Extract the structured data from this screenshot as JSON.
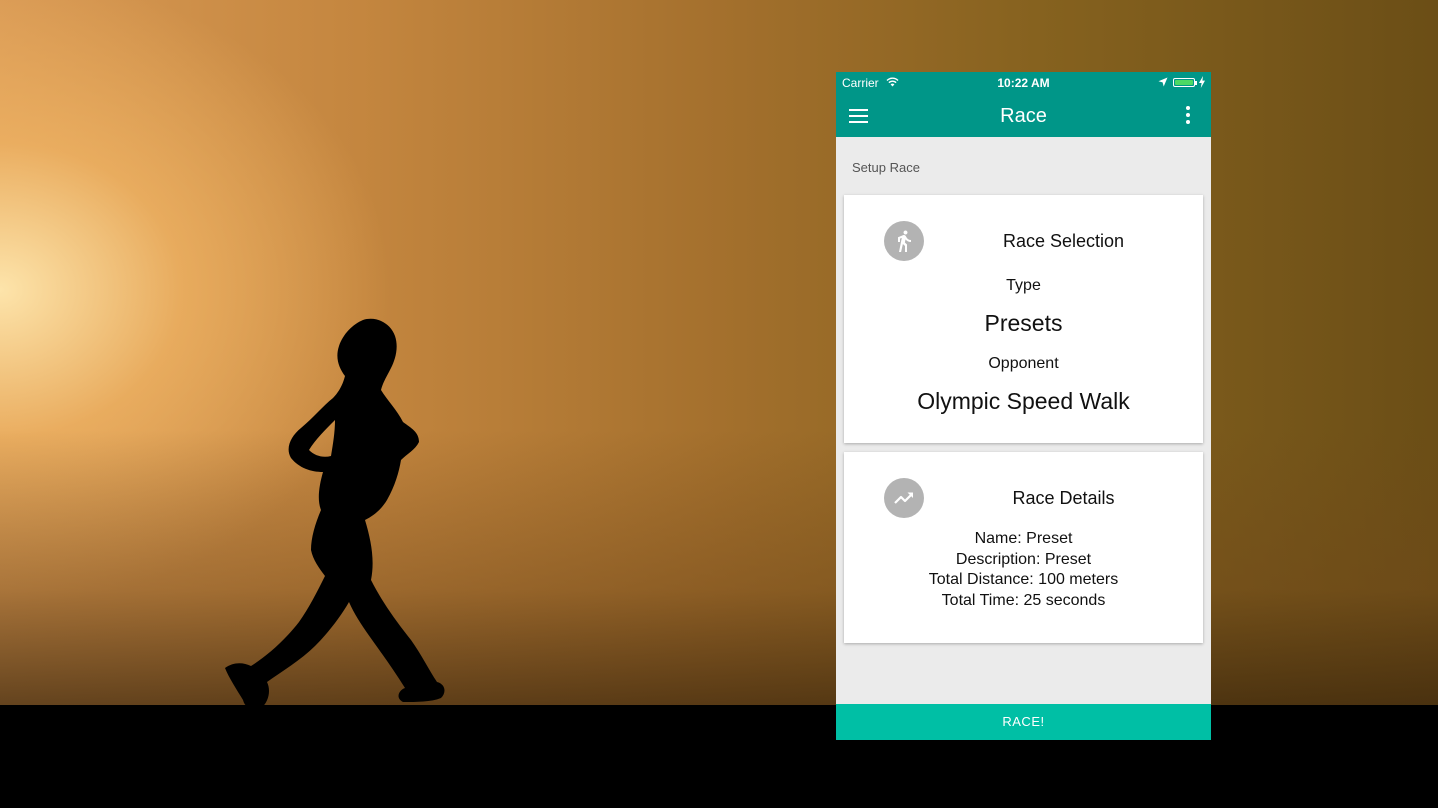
{
  "status_bar": {
    "carrier": "Carrier",
    "time": "10:22 AM",
    "battery_color": "#4cd964"
  },
  "app_bar": {
    "title": "Race",
    "left_icon": "hamburger-menu-icon",
    "right_icon": "more-vert-icon",
    "color": "#009688"
  },
  "section_label": "Setup Race",
  "race_selection": {
    "icon": "directions-run-icon",
    "title": "Race Selection",
    "type_label": "Type",
    "type_value": "Presets",
    "opponent_label": "Opponent",
    "opponent_value": "Olympic Speed Walk"
  },
  "race_details": {
    "icon": "trending-up-icon",
    "title": "Race Details",
    "lines": [
      "Name: Preset",
      "Description: Preset",
      "Total Distance: 100 meters",
      "Total Time: 25 seconds"
    ]
  },
  "race_button": {
    "label": "RACE!",
    "color": "#00bfa5"
  }
}
